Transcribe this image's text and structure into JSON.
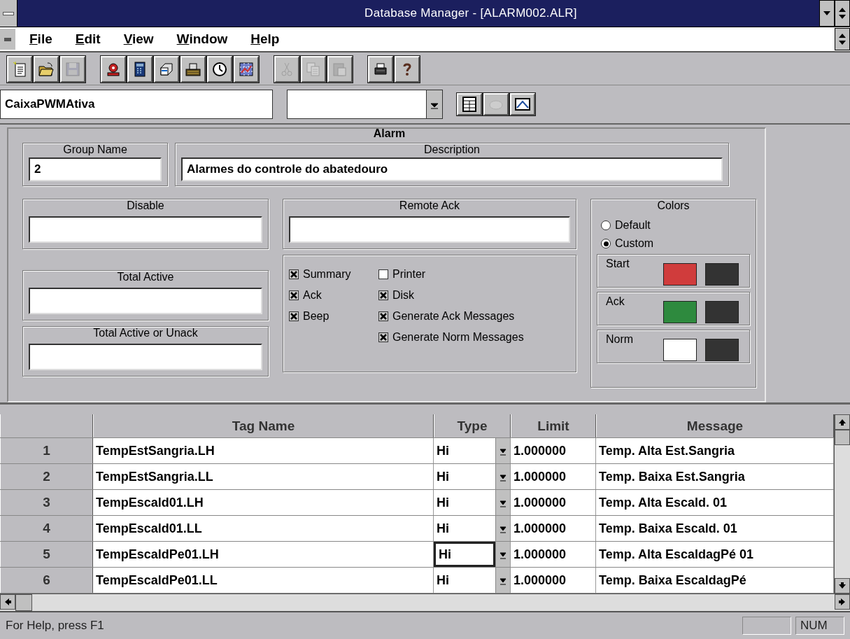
{
  "window": {
    "title": "Database Manager - [ALARM002.ALR]"
  },
  "menu": [
    {
      "label": "File"
    },
    {
      "label": "Edit"
    },
    {
      "label": "View"
    },
    {
      "label": "Window"
    },
    {
      "label": "Help"
    }
  ],
  "toolbar": [
    [
      {
        "disabled": false
      },
      {
        "disabled": false
      },
      {
        "disabled": true
      }
    ],
    [
      {
        "disabled": false
      },
      {
        "disabled": false
      },
      {
        "disabled": false
      },
      {
        "disabled": false
      },
      {
        "disabled": false
      },
      {
        "disabled": false
      }
    ],
    [
      {
        "disabled": true
      },
      {
        "disabled": true
      },
      {
        "disabled": true
      }
    ],
    [
      {
        "disabled": false
      },
      {
        "disabled": false
      }
    ]
  ],
  "tag_bar": {
    "tag_value": "CaixaPWMAtiva",
    "buttons": [
      {
        "disabled": false
      },
      {
        "disabled": true
      },
      {
        "disabled": false
      }
    ]
  },
  "alarm": {
    "title": "Alarm",
    "group_name": {
      "label": "Group Name",
      "value": "2"
    },
    "description": {
      "label": "Description",
      "value": "Alarmes do controle do abatedouro"
    },
    "disable": {
      "label": "Disable"
    },
    "remote_ack": {
      "label": "Remote Ack"
    },
    "total_active": {
      "label": "Total Active"
    },
    "total_active_or_unack": {
      "label": "Total Active or Unack"
    },
    "options": [
      {
        "label": "Summary",
        "checked": true
      },
      {
        "label": "Printer",
        "checked": false
      },
      {
        "label": "Ack",
        "checked": true
      },
      {
        "label": "Disk",
        "checked": true
      },
      {
        "label": "Beep",
        "checked": true
      },
      {
        "label": "Generate Ack Messages",
        "checked": true
      },
      {
        "label": "Generate Norm Messages",
        "checked": true
      }
    ],
    "colors": {
      "label": "Colors",
      "modes": [
        {
          "label": "Default",
          "selected": false
        },
        {
          "label": "Custom",
          "selected": true
        }
      ],
      "states": [
        {
          "label": "Start",
          "swatches": [
            {
              "color": "#d03c3c"
            },
            {
              "color": "#333333"
            }
          ]
        },
        {
          "label": "Ack",
          "swatches": [
            {
              "color": "#2e8a3e"
            },
            {
              "color": "#333333"
            }
          ]
        },
        {
          "label": "Norm",
          "swatches": [
            {
              "color": "#ffffff"
            },
            {
              "color": "#333333"
            }
          ]
        }
      ]
    }
  },
  "table": {
    "columns": [
      "Tag Name",
      "Type",
      "Limit",
      "Message"
    ],
    "rows": [
      {
        "number": "1",
        "tag_name": "TempEstSangria.LH",
        "type": "Hi",
        "limit": "1.000000",
        "message": "Temp. Alta Est.Sangria",
        "focused": false
      },
      {
        "number": "2",
        "tag_name": "TempEstSangria.LL",
        "type": "Hi",
        "limit": "1.000000",
        "message": "Temp. Baixa Est.Sangria",
        "focused": false
      },
      {
        "number": "3",
        "tag_name": "TempEscald01.LH",
        "type": "Hi",
        "limit": "1.000000",
        "message": "Temp. Alta Escald. 01",
        "focused": false
      },
      {
        "number": "4",
        "tag_name": "TempEscald01.LL",
        "type": "Hi",
        "limit": "1.000000",
        "message": "Temp. Baixa Escald. 01",
        "focused": false
      },
      {
        "number": "5",
        "tag_name": "TempEscaldPe01.LH",
        "type": "Hi",
        "limit": "1.000000",
        "message": "Temp. Alta EscaldagPé 01",
        "focused": true
      },
      {
        "number": "6",
        "tag_name": "TempEscaldPe01.LL",
        "type": "Hi",
        "limit": "1.000000",
        "message": "Temp. Baixa EscaldagPé",
        "focused": false
      }
    ]
  },
  "status_bar": {
    "message": "For Help, press F1",
    "indicators": [
      "NUM"
    ]
  }
}
